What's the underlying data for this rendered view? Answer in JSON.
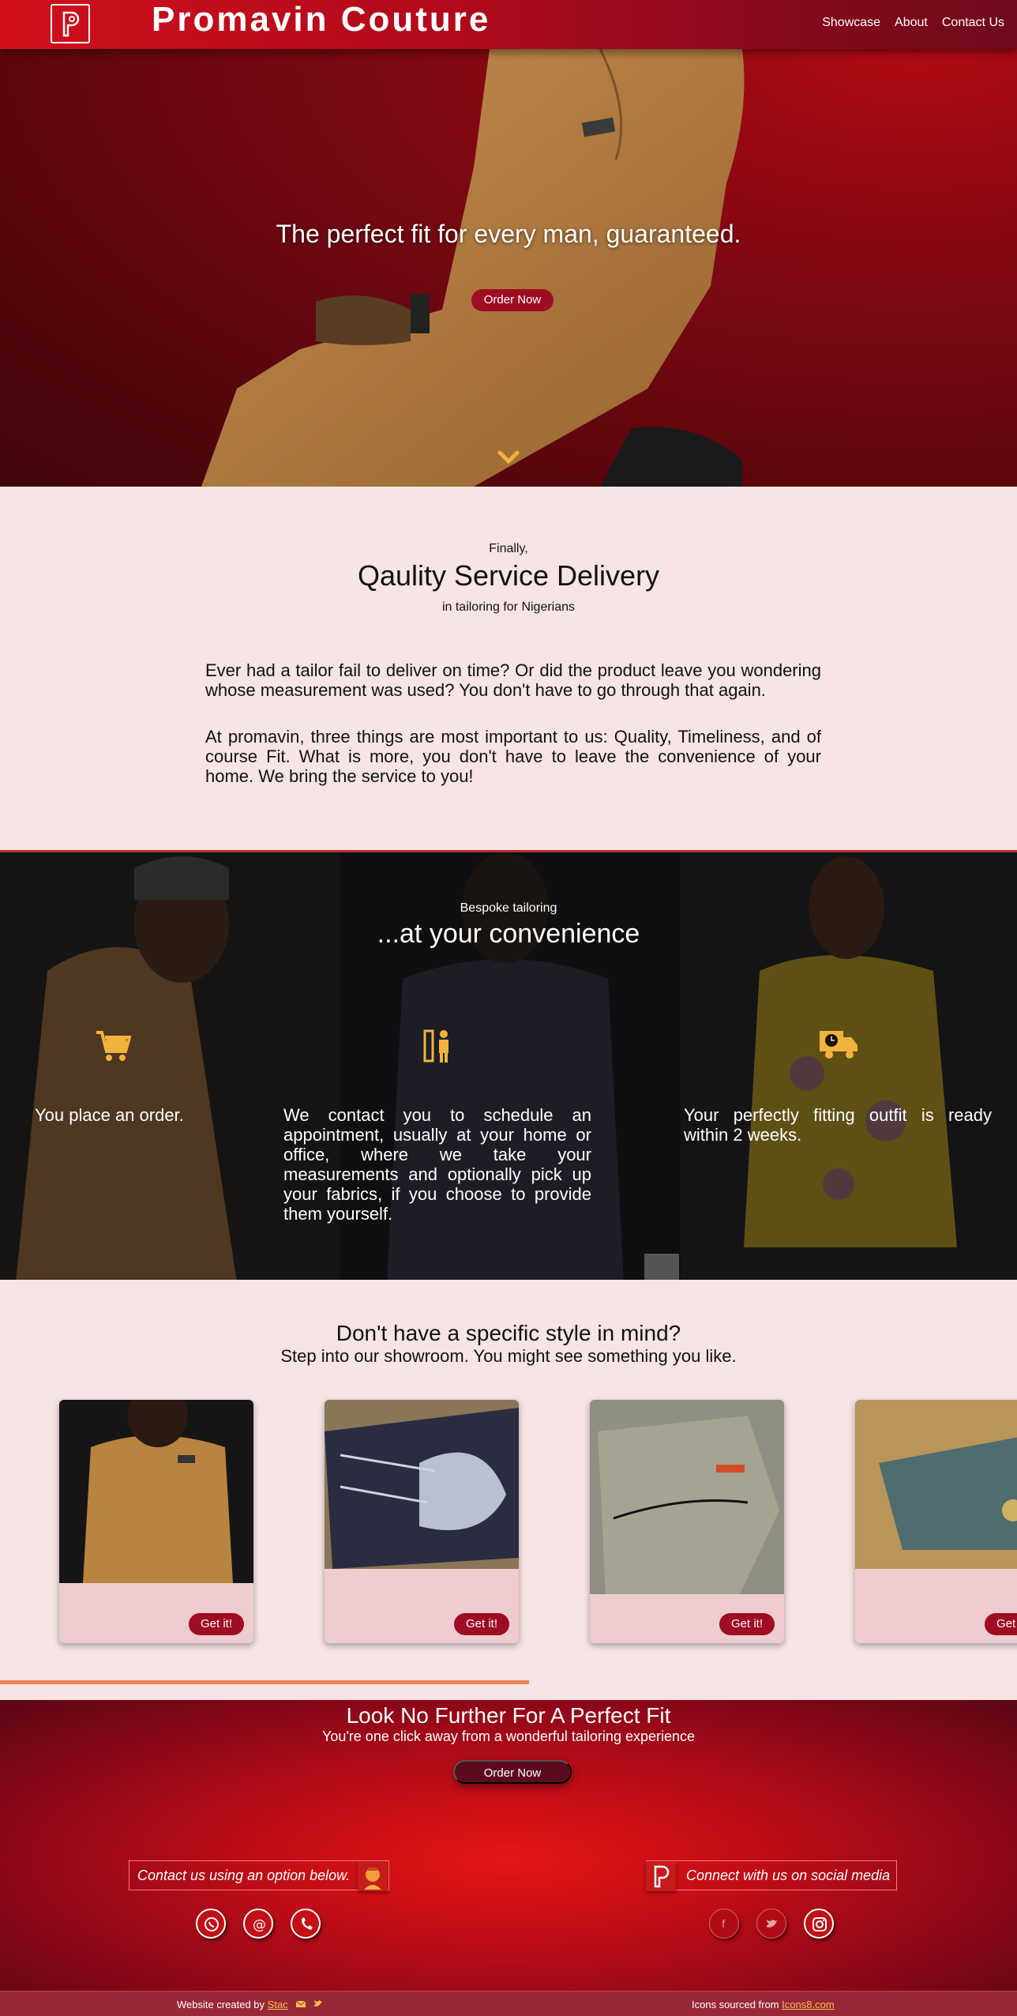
{
  "header": {
    "brand": "Promavin Couture",
    "nav": [
      "Showcase",
      "About",
      "Contact Us"
    ]
  },
  "hero": {
    "title": "The perfect fit for every man, guaranteed.",
    "cta": "Order Now"
  },
  "intro": {
    "eyebrow": "Finally,",
    "title": "Qaulity Service Delivery",
    "sub": "in tailoring for Nigerians",
    "p1": "Ever had a tailor fail to deliver on time? Or did the product leave you wondering whose measurement was used? You don't have to go through that again.",
    "p2": "At promavin, three things are most important to us: Quality, Timeliness, and of course Fit. What is more, you don't have to leave the convenience of your home. We bring the service to you!"
  },
  "process": {
    "eyebrow": "Bespoke tailoring",
    "title": "...at your convenience",
    "steps": [
      {
        "icon": "shopping-cart-icon",
        "text": "You place an order."
      },
      {
        "icon": "measure-person-icon",
        "text": "We contact you to schedule an appointment, usually at your home or office, where we take your measurements and optionally pick up your fabrics, if you choose to provide them yourself."
      },
      {
        "icon": "delivery-truck-icon",
        "text": "Your perfectly fitting outfit is ready within 2 weeks."
      }
    ]
  },
  "showcase": {
    "title": "Don't have a specific style in mind?",
    "sub": "Step into our showroom. You might see something you like.",
    "card_button": "Get it!",
    "scroll_progress": 0.52
  },
  "cta": {
    "title": "Look No Further For A Perfect Fit",
    "sub": "You're one click away from a wonderful tailoring experience",
    "button": "Order Now"
  },
  "contact": {
    "left_label": "Contact us using an option below.",
    "right_label": "Connect with us on social media",
    "contact_icons": [
      "whatsapp-icon",
      "email-icon",
      "phone-icon"
    ],
    "social_icons": [
      "facebook-icon",
      "twitter-icon",
      "instagram-icon"
    ]
  },
  "footer": {
    "created_by_text": "Website created by",
    "creator": "Stac",
    "icons_text": "Icons sourced from",
    "icons_link": "Icons8.com"
  },
  "colors": {
    "accent_red": "#9e0d23",
    "gold": "#f2b33d",
    "page_bg": "#f7e4e5"
  }
}
